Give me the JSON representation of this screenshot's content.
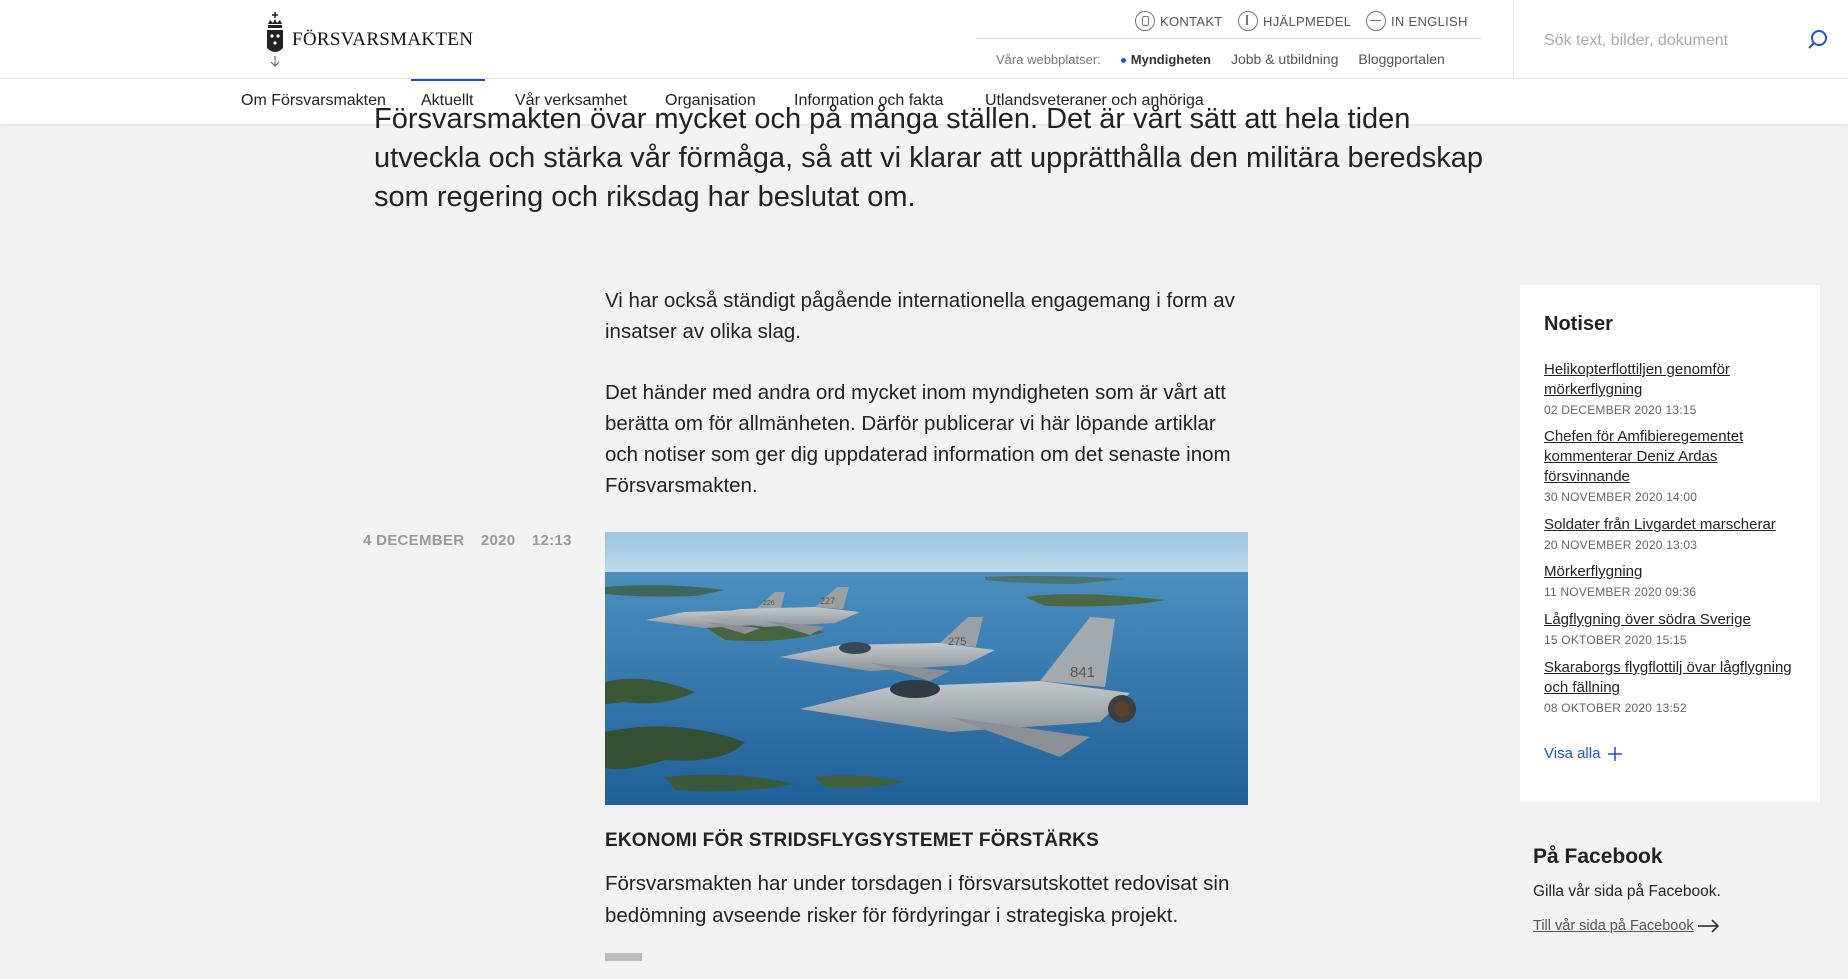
{
  "header": {
    "logo_text": "FÖRSVARSMAKTEN",
    "utility": {
      "kontakt": "KONTAKT",
      "hjalpmedel": "HJÄLPMEDEL",
      "english": "IN ENGLISH"
    },
    "sites": {
      "label": "Våra webbplatser:",
      "items": [
        "Myndigheten",
        "Jobb & utbildning",
        "Bloggportalen"
      ]
    },
    "search_placeholder": "Sök text, bilder, dokument"
  },
  "nav": {
    "items": [
      "Om Försvarsmakten",
      "Aktuellt",
      "Vår verksamhet",
      "Organisation",
      "Information och fakta",
      "Utlandsveteraner och anhöriga"
    ],
    "active": "Aktuellt"
  },
  "lead": "Försvarsmakten övar mycket och på många ställen. Det är vårt sätt att hela tiden utveckla och stärka vår förmåga, så att vi klarar att upprätthålla den militära beredskap som regering och riksdag har beslutat om.",
  "body": {
    "p1": "Vi har också ständigt pågående internationella engagemang i form av insatser av olika slag.",
    "p2": "Det händer med andra ord mycket inom myndigheten som är vårt att berätta om för allmänheten. Därför publicerar vi här löpande artiklar och notiser som ger dig uppdaterad information om det senaste inom Försvarsmakten."
  },
  "article": {
    "day": "4 DECEMBER",
    "year": "2020",
    "time": "12:13",
    "title": "EKONOMI FÖR STRIDSFLYGSYSTEMET FÖRSTÄRKS",
    "summary": "Försvarsmakten har under torsdagen i försvarsutskottet redovisat sin bedömning avseende risker för fördyringar i strategiska projekt.",
    "jet_numbers": [
      "226",
      "227",
      "275",
      "841"
    ]
  },
  "notiser": {
    "title": "Notiser",
    "items": [
      {
        "title": "Helikopterflottiljen genomför mörkerflygning",
        "date": "02 DECEMBER 2020 13:15"
      },
      {
        "title": "Chefen för Amfibieregementet kommenterar Deniz Ardas försvinnande",
        "date": "30 NOVEMBER 2020 14:00"
      },
      {
        "title": "Soldater från Livgardet marscherar",
        "date": "20 NOVEMBER 2020 13:03"
      },
      {
        "title": "Mörkerflygning",
        "date": "11 NOVEMBER 2020 09:36"
      },
      {
        "title": "Lågflygning över södra Sverige",
        "date": "15 OKTOBER 2020 15:15"
      },
      {
        "title": "Skaraborgs flygflottilj övar lågflygning och fällning",
        "date": "08 OKTOBER 2020 13:52"
      }
    ],
    "visa_alla": "Visa alla"
  },
  "facebook": {
    "title": "På Facebook",
    "text": "Gilla vår sida på Facebook.",
    "link": "Till vår sida på Facebook"
  },
  "colors": {
    "accent": "#1d4fd8",
    "background": "#f2f2f2"
  }
}
